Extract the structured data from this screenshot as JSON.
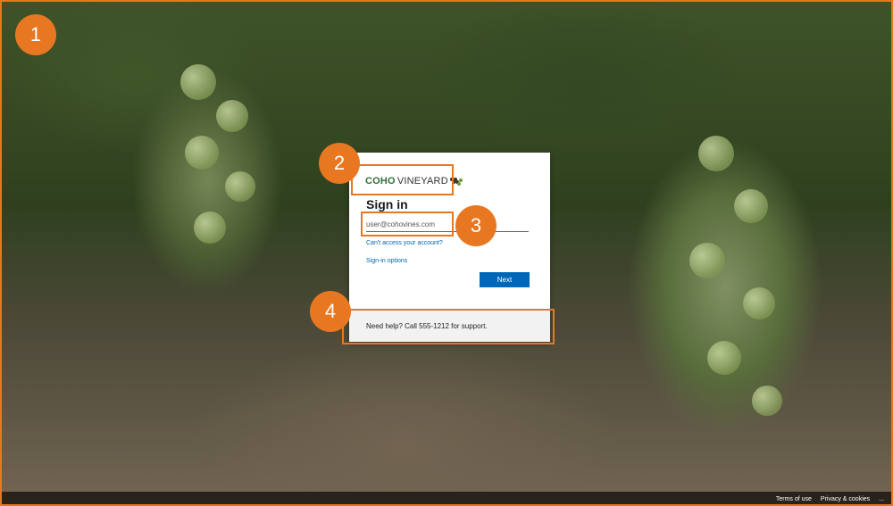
{
  "callouts": [
    "1",
    "2",
    "3",
    "4"
  ],
  "signin": {
    "brand_coho": "COHO",
    "brand_vineyard": "VINEYARD",
    "title": "Sign in",
    "email_value": "user@cohovines.com",
    "cant_access": "Can't access your account?",
    "signin_options": "Sign-in options",
    "next": "Next",
    "help": "Need help? Call 555-1212 for support."
  },
  "footer": {
    "terms": "Terms of use",
    "privacy": "Privacy & cookies",
    "more": "..."
  },
  "colors": {
    "accent": "#e87722",
    "link": "#0067b8",
    "button": "#0067b8",
    "brand_green": "#2f6f3a"
  },
  "icons": {
    "brand_logo": "grape-cluster-icon"
  }
}
